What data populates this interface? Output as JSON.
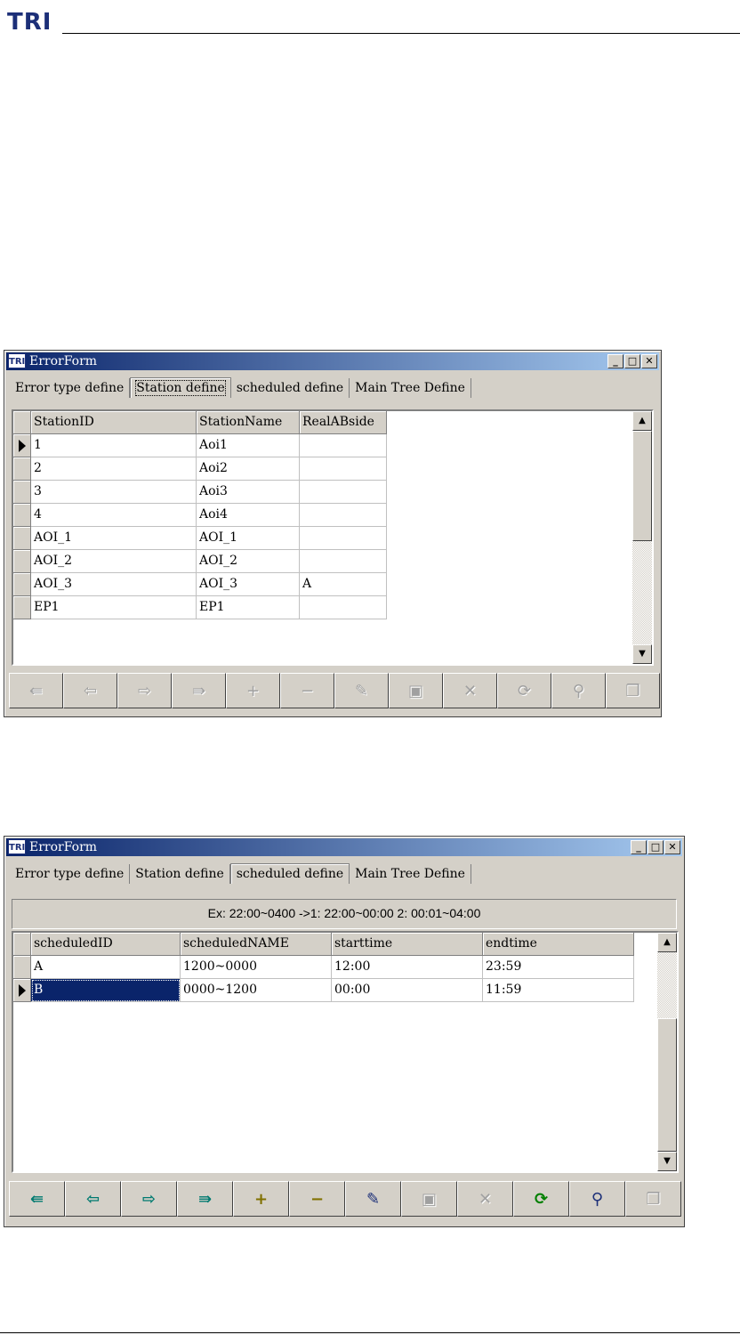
{
  "header": {
    "logo": "TRI"
  },
  "windows": [
    {
      "title": "ErrorForm",
      "app_icon": "TRI",
      "caption_buttons": [
        "minimize-icon",
        "maximize-icon",
        "close-icon"
      ],
      "tabs": [
        "Error type define",
        "Station define",
        "scheduled define",
        "Main Tree Define"
      ],
      "active_tab": "Station define",
      "grid": {
        "columns": [
          "StationID",
          "StationName",
          "RealABside"
        ],
        "rows": [
          [
            "1",
            "Aoi1",
            ""
          ],
          [
            "2",
            "Aoi2",
            ""
          ],
          [
            "3",
            "Aoi3",
            ""
          ],
          [
            "4",
            "Aoi4",
            ""
          ],
          [
            "AOI_1",
            "AOI_1",
            ""
          ],
          [
            "AOI_2",
            "AOI_2",
            ""
          ],
          [
            "AOI_3",
            "AOI_3",
            "A"
          ],
          [
            "EP1",
            "EP1",
            ""
          ]
        ],
        "current_row": 0
      },
      "navigator": {
        "enabled": false,
        "buttons": [
          "first-icon",
          "prior-icon",
          "next-icon",
          "last-icon",
          "insert-icon",
          "delete-icon",
          "edit-icon",
          "post-icon",
          "cancel-icon",
          "refresh-icon",
          "find-icon",
          "copy-icon"
        ]
      }
    },
    {
      "title": "ErrorForm",
      "app_icon": "TRI",
      "caption_buttons": [
        "minimize-icon",
        "maximize-icon",
        "close-icon"
      ],
      "tabs": [
        "Error type define",
        "Station define",
        "scheduled define",
        "Main Tree Define"
      ],
      "active_tab": "scheduled define",
      "hint": "Ex: 22:00~0400 ->1:  22:00~00:00  2: 00:01~04:00",
      "grid": {
        "columns": [
          "scheduledID",
          "scheduledNAME",
          "starttime",
          "endtime"
        ],
        "rows": [
          [
            "A",
            "1200~0000",
            "12:00",
            "23:59"
          ],
          [
            "B",
            "0000~1200",
            "00:00",
            "11:59"
          ]
        ],
        "current_row": 1
      },
      "navigator": {
        "enabled": true,
        "buttons": [
          "first-icon",
          "prior-icon",
          "next-icon",
          "last-icon",
          "insert-icon",
          "delete-icon",
          "edit-icon",
          "post-icon",
          "cancel-icon",
          "refresh-icon",
          "find-icon",
          "copy-icon"
        ],
        "disabled_buttons": [
          "post-icon",
          "cancel-icon",
          "copy-icon"
        ]
      }
    }
  ],
  "colors": {
    "titlebar": "#0a246a",
    "selection": "#0a246a",
    "face": "#d4d0c8",
    "brand": "#1c2f78"
  }
}
